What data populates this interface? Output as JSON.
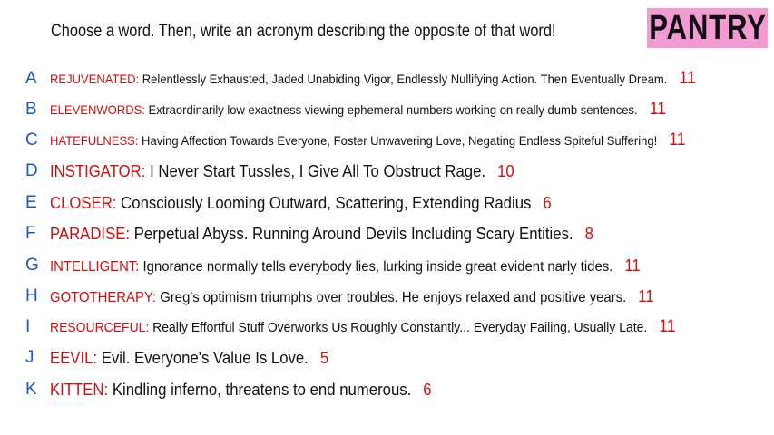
{
  "header": {
    "prompt": "Choose a word. Then, write an acronym describing the opposite of that word!",
    "logo": "PANTRY"
  },
  "rows": [
    {
      "letter": "A",
      "word": "REJUVENATED",
      "definition": "Relentlessly Exhausted, Jaded Unabiding Vigor, Endlessly Nullifying Action. Then Eventually Dream.",
      "score": "11"
    },
    {
      "letter": "B",
      "word": "ELEVENWORDS",
      "definition": "Extraordinarily low exactness viewing ephemeral numbers working on really dumb sentences.",
      "score": "11"
    },
    {
      "letter": "C",
      "word": "HATEFULNESS",
      "definition": "Having Affection Towards Everyone, Foster Unwavering Love, Negating Endless Spiteful Suffering!",
      "score": "11"
    },
    {
      "letter": "D",
      "word": "INSTIGATOR",
      "definition": "I Never Start Tussles, I Give All To Obstruct Rage.",
      "score": "10"
    },
    {
      "letter": "E",
      "word": "CLOSER",
      "definition": "Consciously Looming Outward, Scattering, Extending Radius",
      "score": "6"
    },
    {
      "letter": "F",
      "word": "PARADISE",
      "definition": "Perpetual Abyss. Running Around Devils Including Scary Entities.",
      "score": "8"
    },
    {
      "letter": "G",
      "word": "INTELLIGENT",
      "definition": "Ignorance normally tells everybody lies, lurking inside great evident narly tides.",
      "score": "11"
    },
    {
      "letter": "H",
      "word": "GOTOTHERAPY",
      "definition": "Greg's optimism triumphs over troubles. He enjoys relaxed and positive years.",
      "score": "11"
    },
    {
      "letter": "I",
      "word": "RESOURCEFUL",
      "definition": "Really Effortful Stuff Overworks Us Roughly Constantly... Everyday Failing, Usually Late.",
      "score": "11"
    },
    {
      "letter": "J",
      "word": "EEVIL",
      "definition": "Evil. Everyone's Value Is Love.",
      "score": "5"
    },
    {
      "letter": "K",
      "word": "KITTEN",
      "definition": "Kindling inferno, threatens to end numerous.",
      "score": "6"
    }
  ],
  "colors": {
    "letter": "#1e5ab4",
    "word": "#cc1010",
    "logo_bg": "#f49ad3"
  }
}
